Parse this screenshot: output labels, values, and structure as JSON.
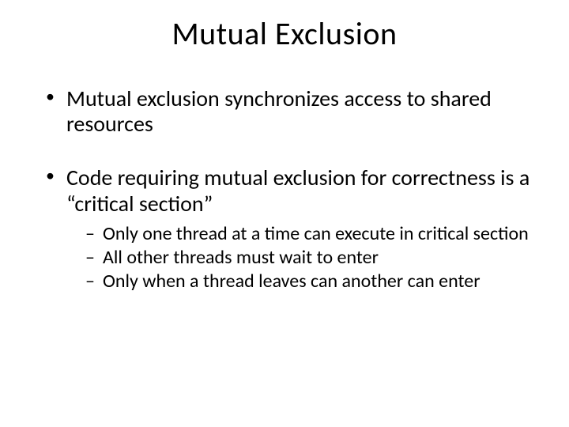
{
  "title": "Mutual Exclusion",
  "bullets": [
    {
      "text": "Mutual exclusion synchronizes access to shared resources",
      "subs": []
    },
    {
      "text": "Code requiring mutual exclusion for correctness is a “critical section”",
      "subs": [
        "Only one thread at a time can execute in critical section",
        "All other threads must wait to enter",
        "Only when a thread leaves can another can enter"
      ]
    }
  ]
}
